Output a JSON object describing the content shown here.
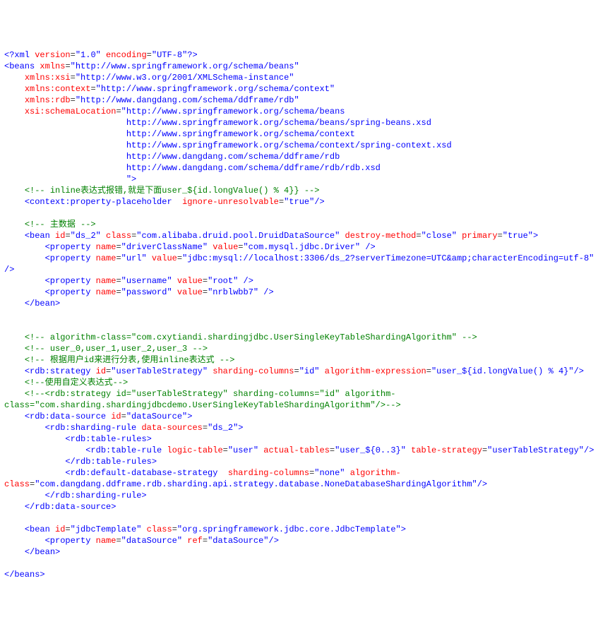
{
  "xml": {
    "pi_open": "<?xml ",
    "version_attr": "version",
    "version_val": "\"1.0\"",
    "encoding_attr": " encoding",
    "encoding_val": "\"UTF-8\"",
    "pi_close": "?>",
    "beans_open": "<beans ",
    "xmlns_attr": "xmlns",
    "xmlns_val": "\"http://www.springframework.org/schema/beans\"",
    "xsi_key": "xmlns:xsi",
    "xsi_val": "\"http://www.w3.org/2001/XMLSchema-instance\"",
    "ctx_key": "xmlns:context",
    "ctx_val": "\"http://www.springframework.org/schema/context\"",
    "rdb_key": "xmlns:rdb",
    "rdb_val": "\"http://www.dangdang.com/schema/ddframe/rdb\"",
    "xsi_loc_key": "xsi:schemaLocation",
    "loc1": "\"http://www.springframework.org/schema/beans",
    "loc2": "http://www.springframework.org/schema/beans/spring-beans.xsd",
    "loc3": "http://www.springframework.org/schema/context",
    "loc4": "http://www.springframework.org/schema/context/spring-context.xsd",
    "loc5": "http://www.dangdang.com/schema/ddframe/rdb",
    "loc6": "http://www.dangdang.com/schema/ddframe/rdb/rdb.xsd",
    "loc_close": "\">",
    "c_inline": "<!-- inline表达式报错,就是下面user_${id.longValue() % 4}} -->",
    "ctx_ph_open": "<context:property-placeholder  ",
    "ignore_attr": "ignore-unresolvable",
    "true_val": "\"true\"",
    "self_close": "/>",
    "c_master": "<!-- 主数据 -->",
    "bean_open": "<bean ",
    "id_attr": "id",
    "ds2_val": "\"ds_2\"",
    "class_attr": " class",
    "ds_class_val": "\"com.alibaba.druid.pool.DruidDataSource\"",
    "destroy_attr": " destroy-method",
    "close_val": "\"close\"",
    "primary_attr": " primary",
    "tag_close": ">",
    "prop_open": "<property ",
    "name_attr": "name",
    "driver_name_val": "\"driverClassName\"",
    "value_attr": " value",
    "driver_val": "\"com.mysql.jdbc.Driver\"",
    "end_tag": " />",
    "url_name_val": "\"url\"",
    "url_val": "\"jdbc:mysql://localhost:3306/ds_2?serverTimezone=UTC&amp;characterEncoding=utf-8\"",
    "tail_close": "/>",
    "user_name_val": "\"username\"",
    "root_val": "\"root\"",
    "pwd_name_val": "\"password\"",
    "pwd_val": "\"nrblwbb7\"",
    "bean_close": "</bean>",
    "c_algo": "<!-- algorithm-class=\"com.cxytiandi.shardingjdbc.UserSingleKeyTableShardingAlgorithm\" -->",
    "c_users": "<!-- user_0,user_1,user_2,user_3 -->",
    "c_shard": "<!-- 根据用户id来进行分表,使用inline表达式 -->",
    "strat_open": "<rdb:strategy ",
    "strat_id_val": "\"userTableStrategy\"",
    "sc_attr": " sharding-columns",
    "id_col_val": "\"id\"",
    "ae_attr": " algorithm-expression",
    "ae_val": "\"user_${id.longValue() % 4}\"",
    "c_custom": "<!--使用自定义表达式-->",
    "c_strat2a": "<!--<rdb:strategy id=\"userTableStrategy\" sharding-columns=\"id\" algorithm-",
    "c_strat2b": "class=\"com.sharding.shardingjdbcdemo.UserSingleKeyTableShardingAlgorithm\"/>-->",
    "ds_open": "<rdb:data-source ",
    "ds_id_val": "\"dataSource\"",
    "sr_open": "<rdb:sharding-rule ",
    "dsrc_attr": "data-sources",
    "tr_open": "<rdb:table-rules>",
    "trule_open": "<rdb:table-rule ",
    "lt_attr": "logic-table",
    "user_val": "\"user\"",
    "at_attr": " actual-tables",
    "at_val": "\"user_${0..3}\"",
    "ts_attr": " table-strategy",
    "tr_close": "</rdb:table-rules>",
    "dds_open": "<rdb:default-database-strategy ",
    "none_val": "\"none\"",
    "ac_attr": " algorithm-",
    "class_attr2": "class",
    "none_class_val": "\"com.dangdang.ddframe.rdb.sharding.api.strategy.database.NoneDatabaseShardingAlgorithm\"",
    "sr_close": "</rdb:sharding-rule>",
    "ds_close": "</rdb:data-source>",
    "jt_id_val": "\"jdbcTemplate\"",
    "jt_class_val": "\"org.springframework.jdbc.core.JdbcTemplate\"",
    "ds_name_val": "\"dataSource\"",
    "ref_attr": " ref",
    "beans_close": "</beans>"
  }
}
